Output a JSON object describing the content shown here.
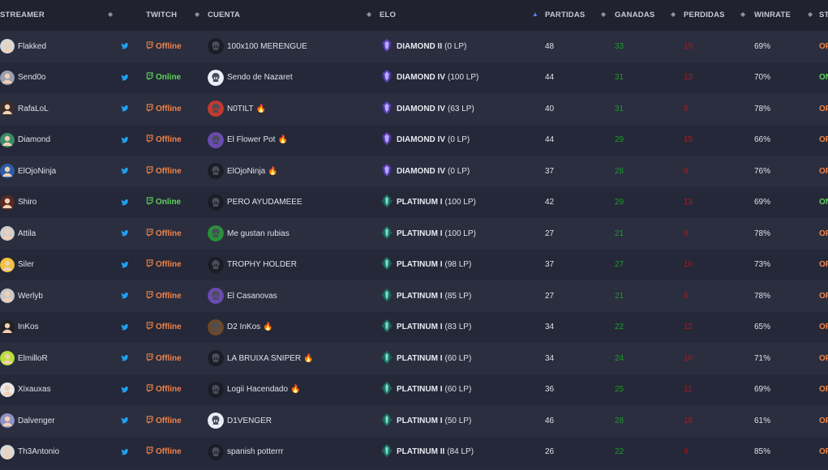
{
  "header": {
    "streamer": "STREAMER",
    "twitch": "TWITCH",
    "cuenta": "CUENTA",
    "elo": "ELO",
    "partidas": "PARTIDAS",
    "ganadas": "GANADAS",
    "perdidas": "PERDIDAS",
    "winrate": "WINRATE",
    "status": "ST"
  },
  "colors": {
    "offline": "#f0834a",
    "online": "#5fd35c",
    "wins": "#1f9a2c",
    "losses": "#b4161a",
    "twitter": "#1da1f2"
  },
  "rows": [
    {
      "streamer": "Flakked",
      "twitch": "Offline",
      "account": "100x100 MERENGUE",
      "fire": "",
      "tier": "DIAMOND II",
      "lp": "(0 LP)",
      "emblem": "diamond",
      "partidas": "48",
      "ganadas": "33",
      "perdidas": "15",
      "winrate": "69%",
      "status": "OF"
    },
    {
      "streamer": "Send0o",
      "twitch": "Online",
      "account": "Sendo de Nazaret",
      "fire": "",
      "tier": "DIAMOND IV",
      "lp": "(100 LP)",
      "emblem": "diamond",
      "partidas": "44",
      "ganadas": "31",
      "perdidas": "13",
      "winrate": "70%",
      "status": "ON"
    },
    {
      "streamer": "RafaLoL",
      "twitch": "Offline",
      "account": "N0TILT",
      "fire": "🔥",
      "tier": "DIAMOND IV",
      "lp": "(63 LP)",
      "emblem": "diamond",
      "partidas": "40",
      "ganadas": "31",
      "perdidas": "9",
      "winrate": "78%",
      "status": "OF"
    },
    {
      "streamer": "Diamond",
      "twitch": "Offline",
      "account": "El Flower Pot",
      "fire": "🔥",
      "tier": "DIAMOND IV",
      "lp": "(0 LP)",
      "emblem": "diamond",
      "partidas": "44",
      "ganadas": "29",
      "perdidas": "15",
      "winrate": "66%",
      "status": "OF"
    },
    {
      "streamer": "ElOjoNinja",
      "twitch": "Offline",
      "account": "ElOjoNinja",
      "fire": "🔥",
      "tier": "DIAMOND IV",
      "lp": "(0 LP)",
      "emblem": "diamond",
      "partidas": "37",
      "ganadas": "28",
      "perdidas": "9",
      "winrate": "76%",
      "status": "OF"
    },
    {
      "streamer": "Shiro",
      "twitch": "Online",
      "account": "PERO AYUDAMEEE",
      "fire": "",
      "tier": "PLATINUM I",
      "lp": "(100 LP)",
      "emblem": "platinum",
      "partidas": "42",
      "ganadas": "29",
      "perdidas": "13",
      "winrate": "69%",
      "status": "ON"
    },
    {
      "streamer": "Attila",
      "twitch": "Offline",
      "account": "Me gustan rubias",
      "fire": "",
      "tier": "PLATINUM I",
      "lp": "(100 LP)",
      "emblem": "platinum",
      "partidas": "27",
      "ganadas": "21",
      "perdidas": "6",
      "winrate": "78%",
      "status": "OF"
    },
    {
      "streamer": "Siler",
      "twitch": "Offline",
      "account": "TROPHY HOLDER",
      "fire": "",
      "tier": "PLATINUM I",
      "lp": "(98 LP)",
      "emblem": "platinum",
      "partidas": "37",
      "ganadas": "27",
      "perdidas": "10",
      "winrate": "73%",
      "status": "OF"
    },
    {
      "streamer": "Werlyb",
      "twitch": "Offline",
      "account": "El Casanovas",
      "fire": "",
      "tier": "PLATINUM I",
      "lp": "(85 LP)",
      "emblem": "platinum",
      "partidas": "27",
      "ganadas": "21",
      "perdidas": "6",
      "winrate": "78%",
      "status": "OF"
    },
    {
      "streamer": "InKos",
      "twitch": "Offline",
      "account": "D2 InKos",
      "fire": "🔥",
      "tier": "PLATINUM I",
      "lp": "(83 LP)",
      "emblem": "platinum",
      "partidas": "34",
      "ganadas": "22",
      "perdidas": "12",
      "winrate": "65%",
      "status": "OF"
    },
    {
      "streamer": "ElmilloR",
      "twitch": "Offline",
      "account": "LA BRUIXA SNIPER",
      "fire": "🔥",
      "tier": "PLATINUM I",
      "lp": "(60 LP)",
      "emblem": "platinum",
      "partidas": "34",
      "ganadas": "24",
      "perdidas": "10",
      "winrate": "71%",
      "status": "OF"
    },
    {
      "streamer": "Xixauxas",
      "twitch": "Offline",
      "account": "Logii Hacendado",
      "fire": "🔥",
      "tier": "PLATINUM I",
      "lp": "(60 LP)",
      "emblem": "platinum",
      "partidas": "36",
      "ganadas": "25",
      "perdidas": "11",
      "winrate": "69%",
      "status": "OF"
    },
    {
      "streamer": "Dalvenger",
      "twitch": "Offline",
      "account": "D1VENGER",
      "fire": "",
      "tier": "PLATINUM I",
      "lp": "(50 LP)",
      "emblem": "platinum",
      "partidas": "46",
      "ganadas": "28",
      "perdidas": "18",
      "winrate": "61%",
      "status": "OF"
    },
    {
      "streamer": "Th3Antonio",
      "twitch": "Offline",
      "account": "spanish potterrr",
      "fire": "",
      "tier": "PLATINUM II",
      "lp": "(84 LP)",
      "emblem": "platinum",
      "partidas": "26",
      "ganadas": "22",
      "perdidas": "4",
      "winrate": "85%",
      "status": "OF"
    }
  ]
}
